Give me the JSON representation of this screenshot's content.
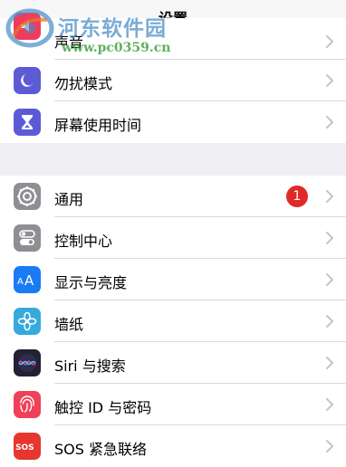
{
  "header": {
    "title": "设置"
  },
  "watermark": {
    "name": "河东软件园",
    "url": "www.pc0359.cn"
  },
  "group1": [
    {
      "label": "声音",
      "icon": "sound-icon",
      "color": "#f03c5c"
    },
    {
      "label": "勿扰模式",
      "icon": "moon-icon",
      "color": "#5b5bd6"
    },
    {
      "label": "屏幕使用时间",
      "icon": "hourglass-icon",
      "color": "#5b5bd6"
    }
  ],
  "group2": [
    {
      "label": "通用",
      "icon": "gear-icon",
      "color": "#8e8e93",
      "badge": "1"
    },
    {
      "label": "控制中心",
      "icon": "toggles-icon",
      "color": "#8e8e93"
    },
    {
      "label": "显示与亮度",
      "icon": "text-size-icon",
      "color": "#1a7cf5"
    },
    {
      "label": "墙纸",
      "icon": "flower-icon",
      "color": "#36aadc"
    },
    {
      "label": "Siri 与搜索",
      "icon": "siri-icon",
      "color": "#222233"
    },
    {
      "label": "触控 ID 与密码",
      "icon": "fingerprint-icon",
      "color": "#f0405a"
    },
    {
      "label": "SOS 紧急联络",
      "icon": "sos-icon",
      "color": "#e5372e"
    }
  ],
  "colors": {
    "header_bg": "#f7f7f7",
    "section_gap": "#efeff4",
    "separator": "#d9d9de",
    "chevron": "#c4c4c9",
    "badge": "#e02a2a"
  }
}
